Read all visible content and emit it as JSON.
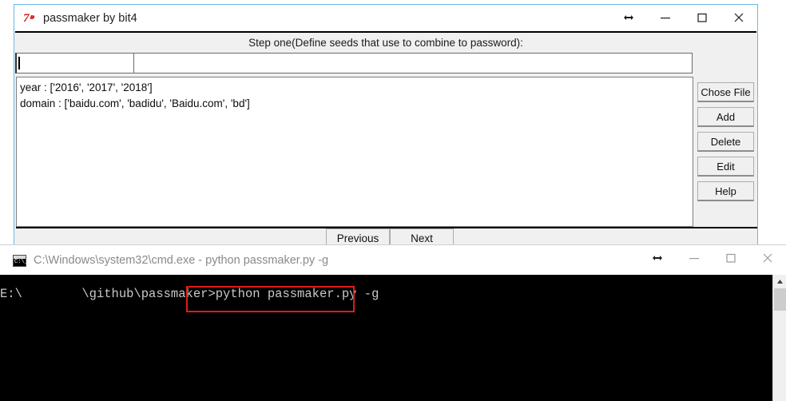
{
  "app_window": {
    "title": "passmaker by bit4",
    "icon": "python-tk-logo-icon",
    "controls": {
      "resize_label": "↔",
      "minimize_label": "—",
      "maximize_label": "□",
      "close_label": "✕"
    },
    "step_label": "Step one(Define seeds that use to combine to password):",
    "entries": [
      {
        "name": "seed-name-entry",
        "value": "",
        "placeholder": ""
      },
      {
        "name": "seed-values-entry",
        "value": "",
        "placeholder": ""
      }
    ],
    "seed_list": [
      "year : ['2016', '2017', '2018']",
      "domain : ['baidu.com', 'badidu', 'Baidu.com', 'bd']"
    ],
    "side_buttons": [
      "Chose File",
      "Add",
      "Delete",
      "Edit",
      "Help"
    ],
    "nav_buttons": [
      "Previous",
      "Next"
    ]
  },
  "cmd_window": {
    "title": "C:\\Windows\\system32\\cmd.exe - python  passmaker.py -g",
    "icon": "cmd-console-icon",
    "icon_prompt_text": "C:\\_",
    "controls": {
      "resize_label": "↔",
      "minimize_label": "—",
      "maximize_label": "□",
      "close_label": "✕"
    },
    "console_line": "E:\\        \\github\\passmaker>python passmaker.py -g",
    "highlight_color": "#e01b1b",
    "highlighted_command": "python passmaker.py -g",
    "scrollbar": {
      "up_arrow": "▲"
    }
  }
}
